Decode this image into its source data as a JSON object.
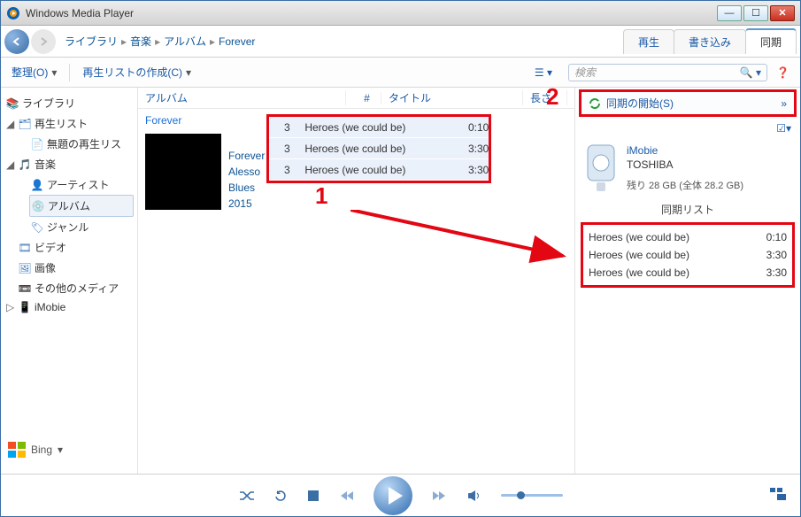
{
  "window": {
    "title": "Windows Media Player"
  },
  "breadcrumb": [
    "ライブラリ",
    "音楽",
    "アルバム",
    "Forever"
  ],
  "right_tabs": {
    "play": "再生",
    "write": "書き込み",
    "sync": "同期"
  },
  "toolbar": {
    "organize": "整理(O)",
    "create_playlist": "再生リストの作成(C)"
  },
  "search": {
    "placeholder": "検索"
  },
  "tree": {
    "library": "ライブラリ",
    "playlists": "再生リスト",
    "untitled_playlist": "無題の再生リス",
    "music": "音楽",
    "artist": "アーティスト",
    "album": "アルバム",
    "genre": "ジャンル",
    "video": "ビデオ",
    "pictures": "画像",
    "other_media": "その他のメディア",
    "imobie": "iMobie"
  },
  "columns": {
    "album": "アルバム",
    "num": "#",
    "title": "タイトル",
    "len": "長さ"
  },
  "album_label": "Forever",
  "album": {
    "title": "Forever",
    "artist": "Alesso",
    "genre": "Blues",
    "year": "2015"
  },
  "tracks": [
    {
      "num": "3",
      "title": "Heroes (we could be)",
      "len": "0:10"
    },
    {
      "num": "3",
      "title": "Heroes (we could be)",
      "len": "3:30"
    },
    {
      "num": "3",
      "title": "Heroes (we could be)",
      "len": "3:30"
    }
  ],
  "sync": {
    "start_label": "同期の開始(S)",
    "device_name": "iMobie",
    "device_maker": "TOSHIBA",
    "device_space": "残り 28 GB (全体 28.2 GB)",
    "list_label": "同期リスト",
    "list": [
      {
        "title": "Heroes (we could be)",
        "len": "0:10"
      },
      {
        "title": "Heroes (we could be)",
        "len": "3:30"
      },
      {
        "title": "Heroes (we could be)",
        "len": "3:30"
      }
    ]
  },
  "bing": "Bing",
  "annotations": {
    "step1": "1",
    "step2": "2"
  }
}
